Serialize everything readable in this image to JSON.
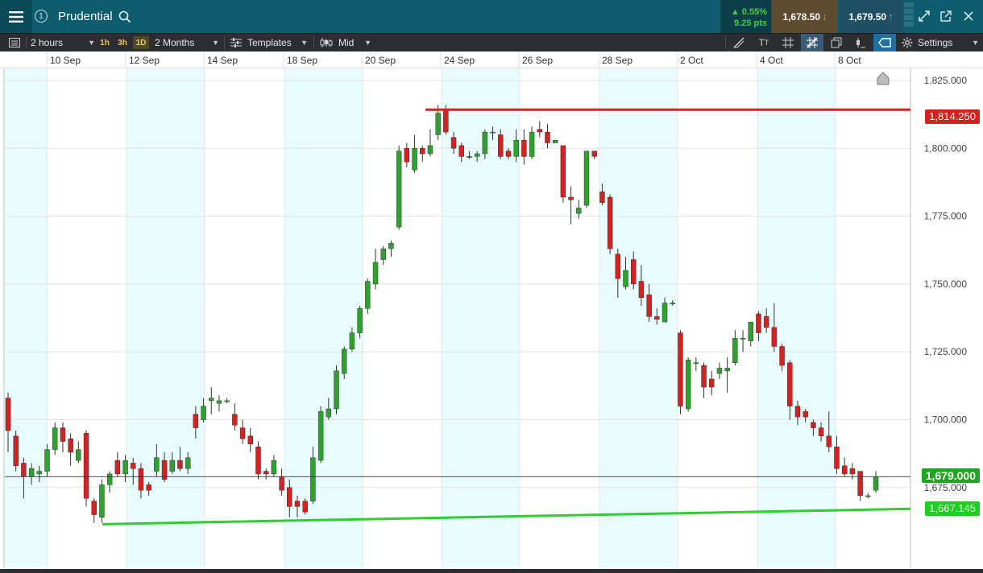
{
  "header": {
    "instrument": "Prudential",
    "account_badge": "1",
    "change_pct": "▲ 0.55%",
    "change_pts": "9.25 pts",
    "sell_price": "1,678.50",
    "buy_price": "1,679.50"
  },
  "toolbar": {
    "interval": "2 hours",
    "tf_1h": "1h",
    "tf_3h": "3h",
    "tf_1d": "1D",
    "range": "2 Months",
    "templates": "Templates",
    "price_type": "Mid",
    "settings": "Settings"
  },
  "dates": [
    "10 Sep",
    "12 Sep",
    "14 Sep",
    "18 Sep",
    "20 Sep",
    "24 Sep",
    "26 Sep",
    "28 Sep",
    "2 Oct",
    "4 Oct",
    "8 Oct"
  ],
  "colors": {
    "up": "#2fa12f",
    "down": "#d42121",
    "resistance": "#e02020",
    "support": "#2fcd2f",
    "band": "#e8fbfd"
  },
  "chart_data": {
    "type": "candlestick",
    "y_ticks": [
      "1,825.000",
      "1,800.000",
      "1,775.000",
      "1,750.000",
      "1,725.000",
      "1,700.000",
      "1,675.000"
    ],
    "y_tick_values": [
      1825,
      1800,
      1775,
      1750,
      1725,
      1700,
      1675
    ],
    "ylim": [
      1652,
      1832
    ],
    "resistance_label": "1,814.250",
    "resistance_value": 1814.25,
    "current_label": "1,679.000",
    "current_value": 1679.0,
    "support_label": "1,667.145",
    "support_start_value": 1661.5,
    "support_end_value": 1667.145,
    "candles": [
      [
        1708,
        1696,
        1710,
        1688
      ],
      [
        1694,
        1683,
        1696,
        1681
      ],
      [
        1684,
        1679,
        1686,
        1671
      ],
      [
        1679,
        1682,
        1684,
        1676
      ],
      [
        1680,
        1681,
        1683,
        1677
      ],
      [
        1681,
        1689,
        1691,
        1679
      ],
      [
        1689,
        1697,
        1699,
        1687
      ],
      [
        1697,
        1692,
        1699,
        1688
      ],
      [
        1693,
        1688,
        1695,
        1683
      ],
      [
        1685,
        1689,
        1692,
        1684
      ],
      [
        1695,
        1671,
        1696,
        1668
      ],
      [
        1670,
        1665,
        1671,
        1662
      ],
      [
        1664,
        1676,
        1678,
        1662
      ],
      [
        1676,
        1680,
        1681,
        1673
      ],
      [
        1685,
        1680,
        1688,
        1679
      ],
      [
        1680,
        1685,
        1687,
        1677
      ],
      [
        1684,
        1682,
        1686,
        1676
      ],
      [
        1682,
        1674,
        1684,
        1671
      ],
      [
        1676,
        1674,
        1677,
        1672
      ],
      [
        1681,
        1686,
        1691,
        1679
      ],
      [
        1685,
        1678,
        1688,
        1677
      ],
      [
        1681,
        1685,
        1688,
        1680
      ],
      [
        1685,
        1682,
        1690,
        1681
      ],
      [
        1682,
        1686,
        1688,
        1680
      ],
      [
        1702,
        1697,
        1705,
        1693
      ],
      [
        1700,
        1705,
        1708,
        1699
      ],
      [
        1707,
        1708,
        1712,
        1702
      ],
      [
        1706,
        1707,
        1709,
        1703
      ],
      [
        1707,
        1707,
        1708,
        1706
      ],
      [
        1702,
        1698,
        1706,
        1696
      ],
      [
        1697,
        1693,
        1700,
        1691
      ],
      [
        1694,
        1691,
        1697,
        1688
      ],
      [
        1690,
        1680,
        1692,
        1678
      ],
      [
        1681,
        1680,
        1682,
        1678
      ],
      [
        1680,
        1685,
        1687,
        1679
      ],
      [
        1679,
        1674,
        1682,
        1672
      ],
      [
        1675,
        1668,
        1678,
        1664
      ],
      [
        1670,
        1668,
        1672,
        1664
      ],
      [
        1670,
        1666,
        1671,
        1665
      ],
      [
        1670,
        1686,
        1690,
        1669
      ],
      [
        1685,
        1703,
        1705,
        1684
      ],
      [
        1701,
        1704,
        1708,
        1700
      ],
      [
        1704,
        1718,
        1720,
        1702
      ],
      [
        1717,
        1726,
        1727,
        1715
      ],
      [
        1726,
        1732,
        1734,
        1725
      ],
      [
        1732,
        1741,
        1742,
        1730
      ],
      [
        1741,
        1751,
        1752,
        1739
      ],
      [
        1750,
        1758,
        1763,
        1748
      ],
      [
        1759,
        1763,
        1764,
        1757
      ],
      [
        1763,
        1765,
        1766,
        1760
      ],
      [
        1771,
        1799,
        1801,
        1770
      ],
      [
        1800,
        1795,
        1802,
        1793
      ],
      [
        1792,
        1800,
        1805,
        1791
      ],
      [
        1800,
        1798,
        1801,
        1795
      ],
      [
        1798,
        1801,
        1807,
        1797
      ],
      [
        1805,
        1813,
        1816,
        1803
      ],
      [
        1814,
        1806,
        1816,
        1805
      ],
      [
        1804,
        1800,
        1806,
        1798
      ],
      [
        1801,
        1797,
        1802,
        1795
      ],
      [
        1797,
        1797,
        1799,
        1796
      ],
      [
        1797,
        1798,
        1799,
        1795
      ],
      [
        1798,
        1806,
        1807,
        1796
      ],
      [
        1806,
        1806,
        1808,
        1803
      ],
      [
        1805,
        1797,
        1807,
        1796
      ],
      [
        1799,
        1797,
        1800,
        1796
      ],
      [
        1797,
        1803,
        1807,
        1795
      ],
      [
        1803,
        1797,
        1807,
        1794
      ],
      [
        1797,
        1806,
        1808,
        1796
      ],
      [
        1807,
        1806,
        1810,
        1804
      ],
      [
        1806,
        1802,
        1809,
        1800
      ],
      [
        1802,
        1803,
        1803,
        1802
      ],
      [
        1801,
        1782,
        1801,
        1780
      ],
      [
        1782,
        1781,
        1786,
        1772
      ],
      [
        1776,
        1778,
        1781,
        1774
      ],
      [
        1779,
        1799,
        1799,
        1778
      ],
      [
        1799,
        1797,
        1799,
        1796
      ],
      [
        1784,
        1780,
        1787,
        1779
      ],
      [
        1782,
        1763,
        1783,
        1761
      ],
      [
        1761,
        1752,
        1763,
        1745
      ],
      [
        1749,
        1755,
        1760,
        1748
      ],
      [
        1759,
        1750,
        1762,
        1748
      ],
      [
        1751,
        1745,
        1757,
        1742
      ],
      [
        1746,
        1738,
        1750,
        1736
      ],
      [
        1738,
        1737,
        1741,
        1735
      ],
      [
        1736,
        1743,
        1745,
        1736
      ],
      [
        1743,
        1743,
        1744,
        1742
      ],
      [
        1732,
        1705,
        1733,
        1702
      ],
      [
        1704,
        1722,
        1723,
        1703
      ],
      [
        1721,
        1721,
        1723,
        1718
      ],
      [
        1720,
        1712,
        1721,
        1708
      ],
      [
        1715,
        1712,
        1718,
        1709
      ],
      [
        1717,
        1719,
        1721,
        1715
      ],
      [
        1718,
        1719,
        1723,
        1710
      ],
      [
        1721,
        1730,
        1733,
        1720
      ],
      [
        1730,
        1730,
        1733,
        1725
      ],
      [
        1729,
        1736,
        1736,
        1727
      ],
      [
        1739,
        1732,
        1740,
        1729
      ],
      [
        1738,
        1734,
        1741,
        1732
      ],
      [
        1734,
        1727,
        1743,
        1725
      ],
      [
        1727,
        1720,
        1728,
        1718
      ],
      [
        1721,
        1705,
        1722,
        1700
      ],
      [
        1705,
        1701,
        1707,
        1698
      ],
      [
        1703,
        1701,
        1704,
        1699
      ],
      [
        1699,
        1697,
        1700,
        1694
      ],
      [
        1697,
        1694,
        1699,
        1692
      ],
      [
        1694,
        1690,
        1703,
        1688
      ],
      [
        1690,
        1682,
        1694,
        1680
      ],
      [
        1683,
        1680,
        1686,
        1679
      ],
      [
        1682,
        1680,
        1684,
        1678
      ],
      [
        1681,
        1672,
        1681,
        1670
      ],
      [
        1672,
        1672,
        1673,
        1671
      ],
      [
        1674,
        1679,
        1681,
        1673
      ]
    ]
  }
}
